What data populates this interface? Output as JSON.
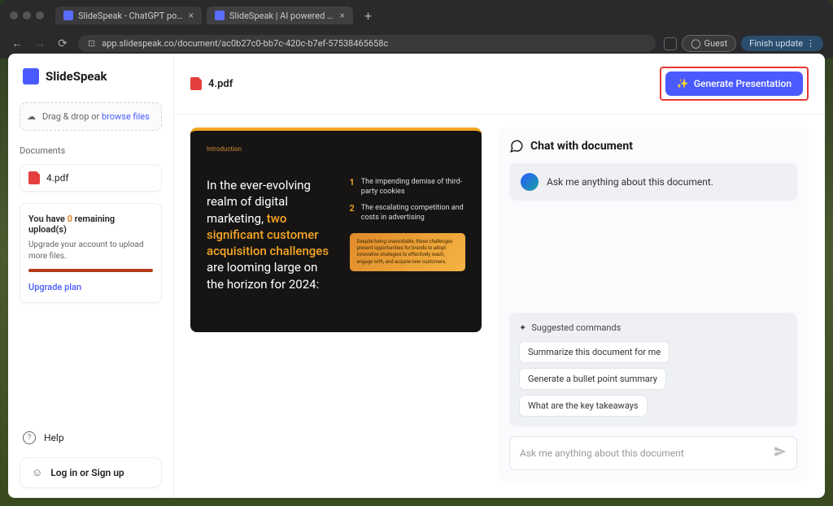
{
  "browser": {
    "tabs": [
      {
        "title": "SlideSpeak - ChatGPT powe"
      },
      {
        "title": "SlideSpeak | AI powered pres"
      }
    ],
    "url": "app.slidespeak.co/document/ac0b27c0-bb7c-420c-b7ef-57538465658c",
    "guest_label": "Guest",
    "finish_label": "Finish update"
  },
  "sidebar": {
    "brand": "SlideSpeak",
    "dropzone_prefix": "Drag & drop or ",
    "dropzone_link": "browse files",
    "documents_label": "Documents",
    "doc_name": "4.pdf",
    "uploads_prefix": "You have ",
    "uploads_count": "0",
    "uploads_suffix": " remaining upload(s)",
    "uploads_desc": "Upgrade your account to upload more files.",
    "upgrade_link": "Upgrade plan",
    "help_label": "Help",
    "login_label": "Log in or Sign up"
  },
  "topbar": {
    "doc_title": "4.pdf",
    "generate_label": "Generate Presentation"
  },
  "slide": {
    "section": "Introduction",
    "heading_p1": "In the ever-evolving realm of digital marketing, ",
    "heading_hl": "two significant customer acquisition challenges",
    "heading_p2": " are looming large on the horizon for 2024:",
    "item1_num": "1",
    "item1_text": "The impending demise of third-party cookies",
    "item2_num": "2",
    "item2_text": "The escalating competition and costs in advertising",
    "callout": "Despite being unavoidable, these challenges present opportunities for brands to adopt innovative strategies to effectively reach, engage with, and acquire new customers."
  },
  "chat": {
    "header": "Chat with document",
    "assistant_greeting": "Ask me anything about this document.",
    "suggested_label": "Suggested commands",
    "suggestions": {
      "s1": "Summarize this document for me",
      "s2": "Generate a bullet point summary",
      "s3": "What are the key takeaways"
    },
    "input_placeholder": "Ask me anything about this document"
  }
}
